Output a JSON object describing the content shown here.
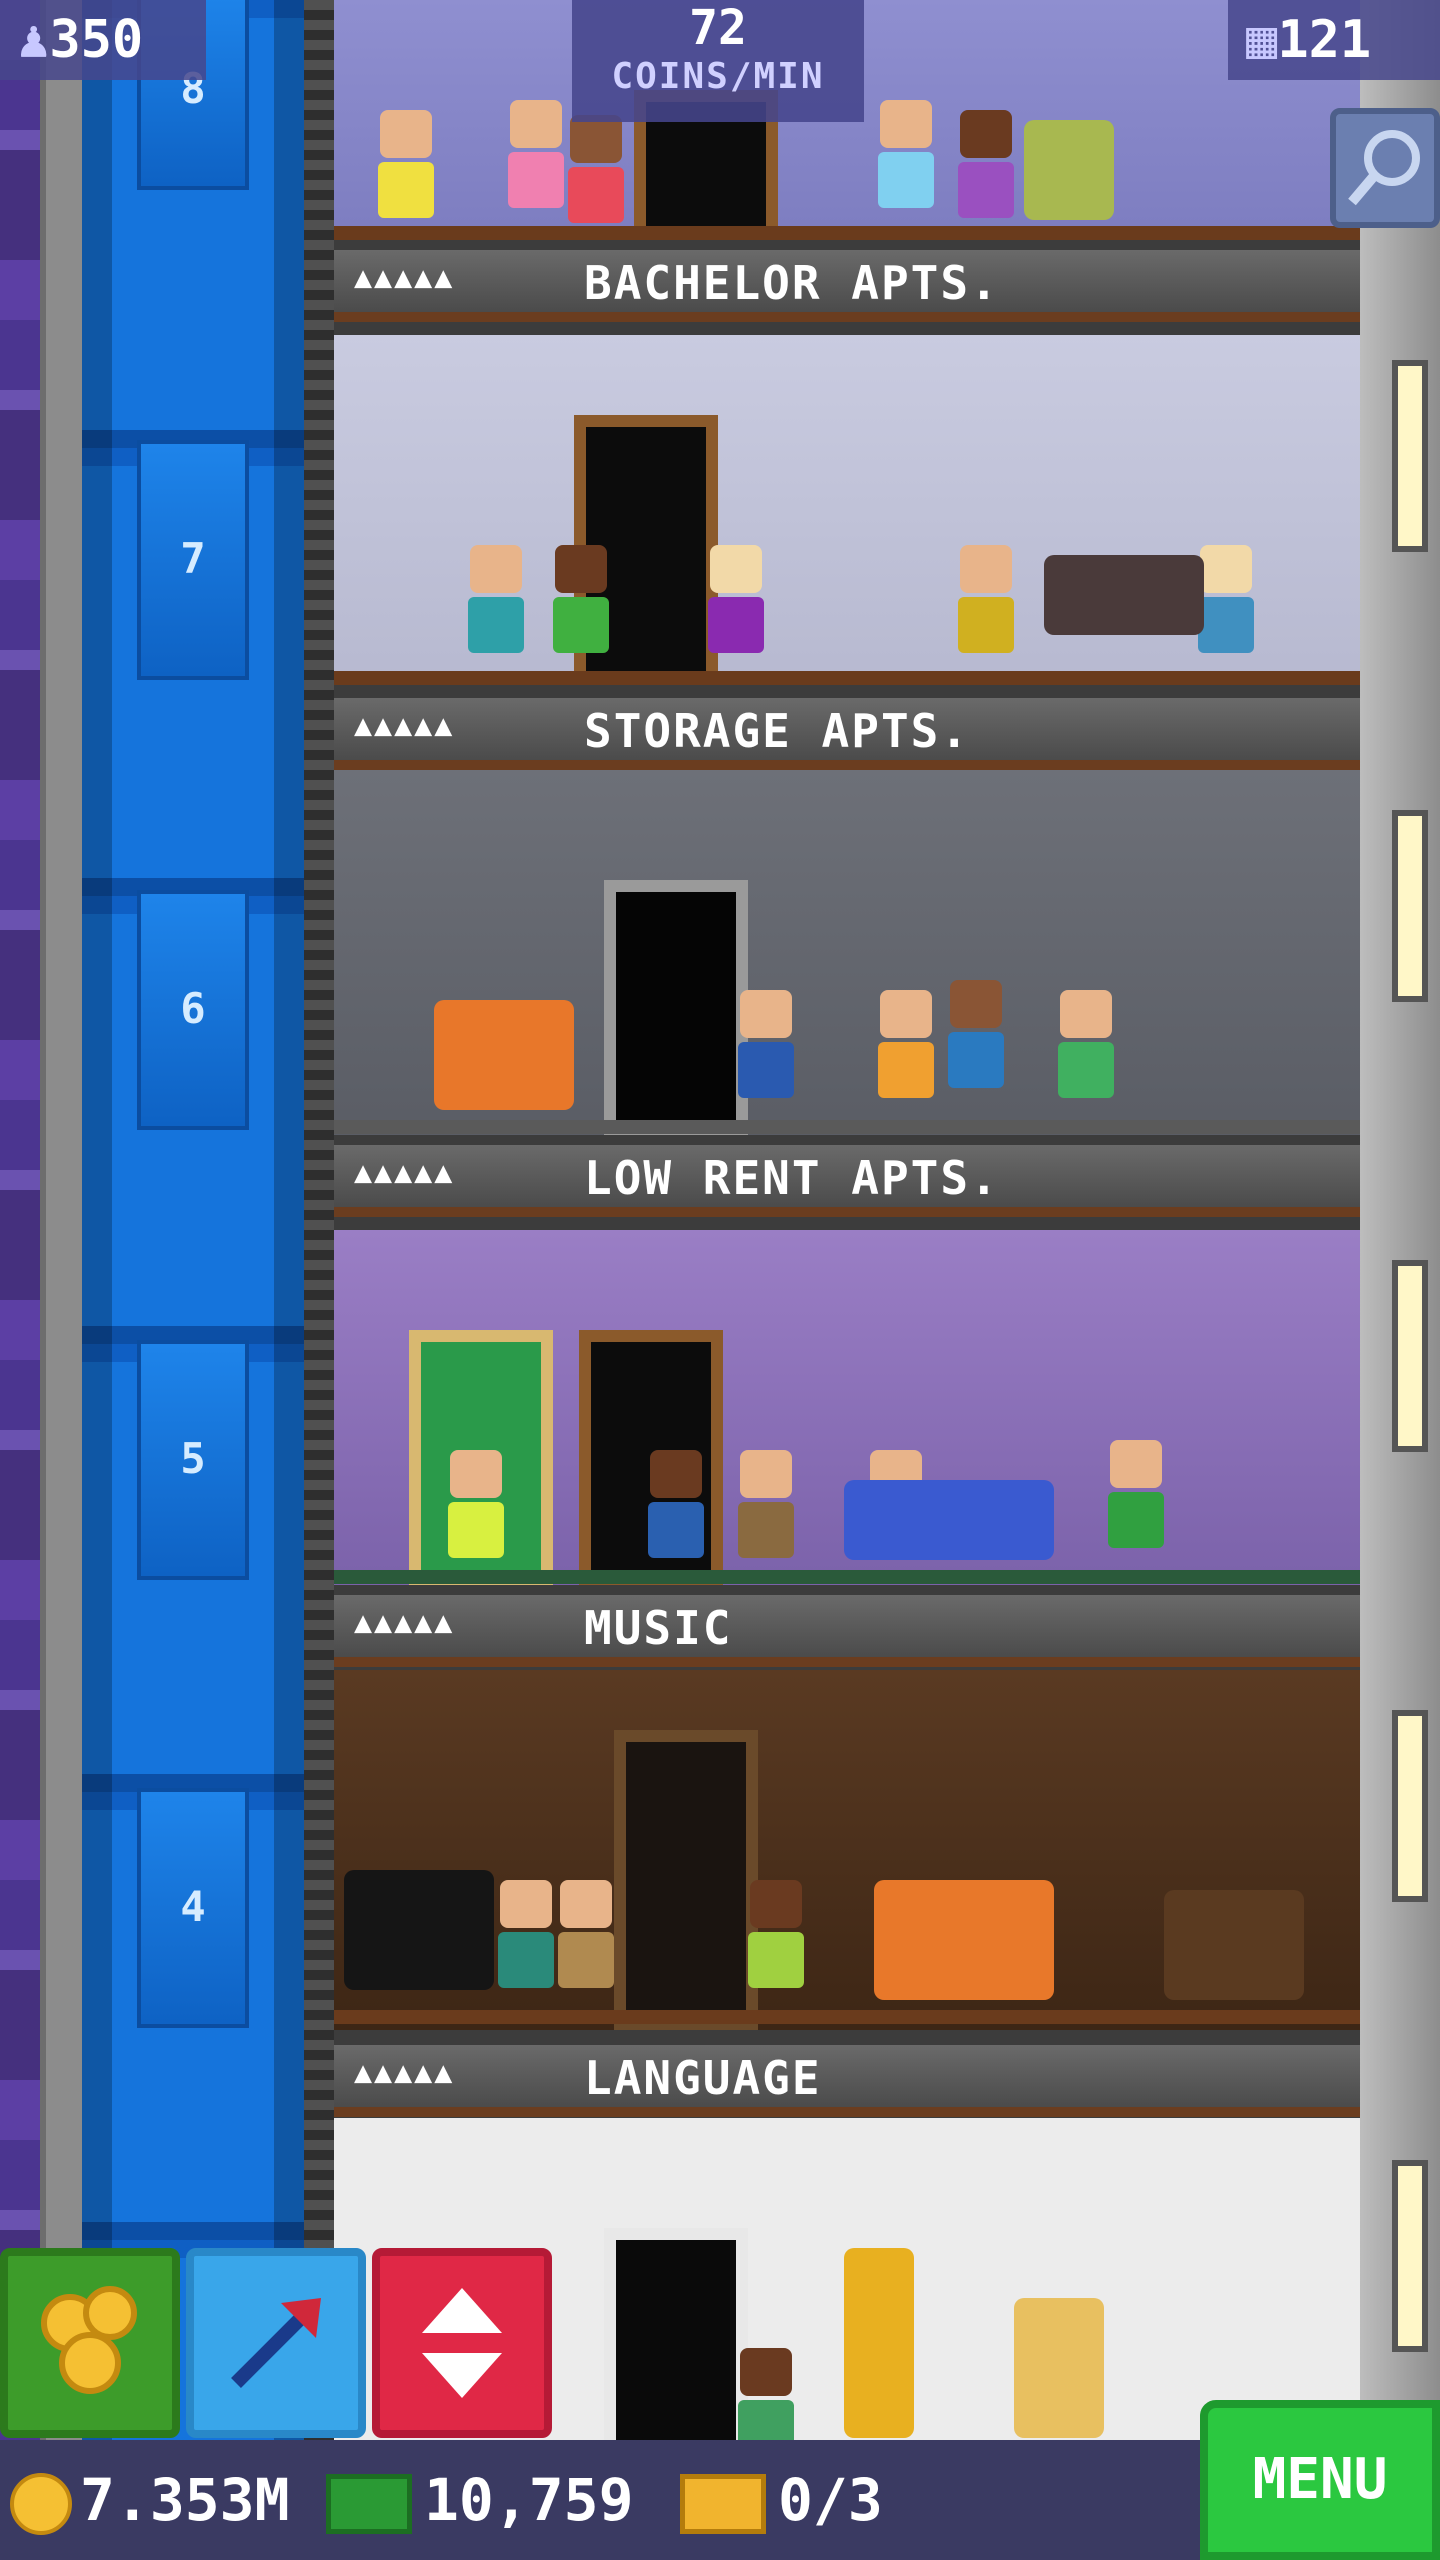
{
  "hud": {
    "population": "350",
    "coins_per_min_value": "72",
    "coins_per_min_unit": "COINS/MIN",
    "floors_count": "121"
  },
  "shaft_floors": [
    "8",
    "7",
    "6",
    "5",
    "4"
  ],
  "rooms": [
    {
      "name": "BACHELOR APTS.",
      "stars": "▲▲▲▲▲"
    },
    {
      "name": "STORAGE APTS.",
      "stars": "▲▲▲▲▲"
    },
    {
      "name": "LOW RENT APTS.",
      "stars": "▲▲▲▲▲"
    },
    {
      "name": "MUSIC",
      "stars": "▲▲▲▲▲"
    },
    {
      "name": "LANGUAGE",
      "stars": "▲▲▲▲▲"
    }
  ],
  "bottom": {
    "coins": "7.353M",
    "bux": "10,759",
    "tickets": "0/3",
    "menu_label": "MENU"
  },
  "icons": [
    "person-icon",
    "floors-icon",
    "search-icon",
    "coins-icon",
    "arrow-icon",
    "elevator-icon",
    "coin-icon",
    "bux-icon",
    "ticket-icon"
  ],
  "colors": {
    "menu": "#2bc840",
    "coins_button": "#3d9c2a",
    "arrow_button": "#39a6ea",
    "elevator_button": "#e02846",
    "shaft": "#1574dc"
  }
}
